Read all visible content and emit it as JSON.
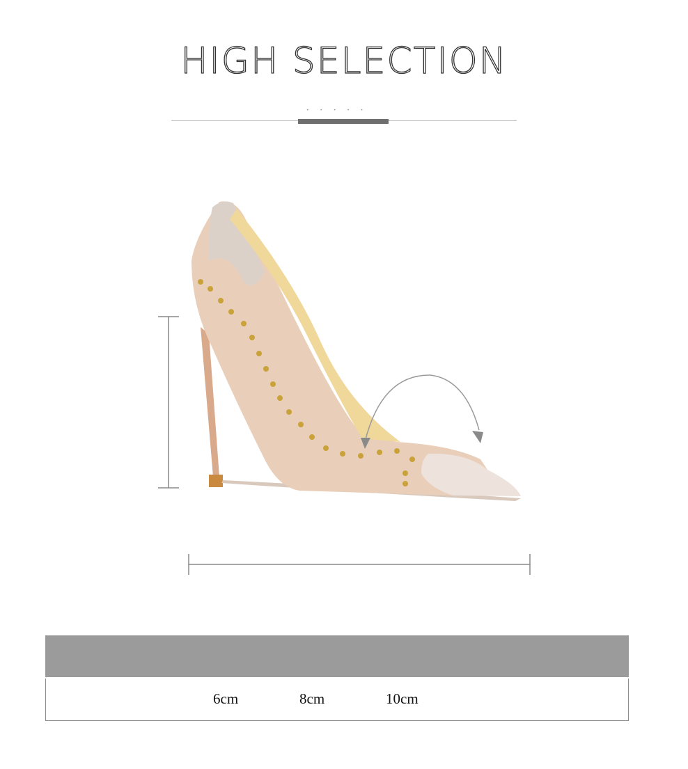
{
  "header": {
    "title": "HIGH SELECTION"
  },
  "heel_heights": [
    "6cm",
    "8cm",
    "10cm"
  ],
  "colors": {
    "accent_band": "#9b9b9b",
    "rule": "#6f6f6f",
    "suede": "#e8cdb6",
    "patent": "#ede2dc",
    "studs": "#c9a23a"
  },
  "icons": [
    "shoe-illustration",
    "height-bracket-icon",
    "length-bracket-icon",
    "curved-arrow-icon"
  ]
}
